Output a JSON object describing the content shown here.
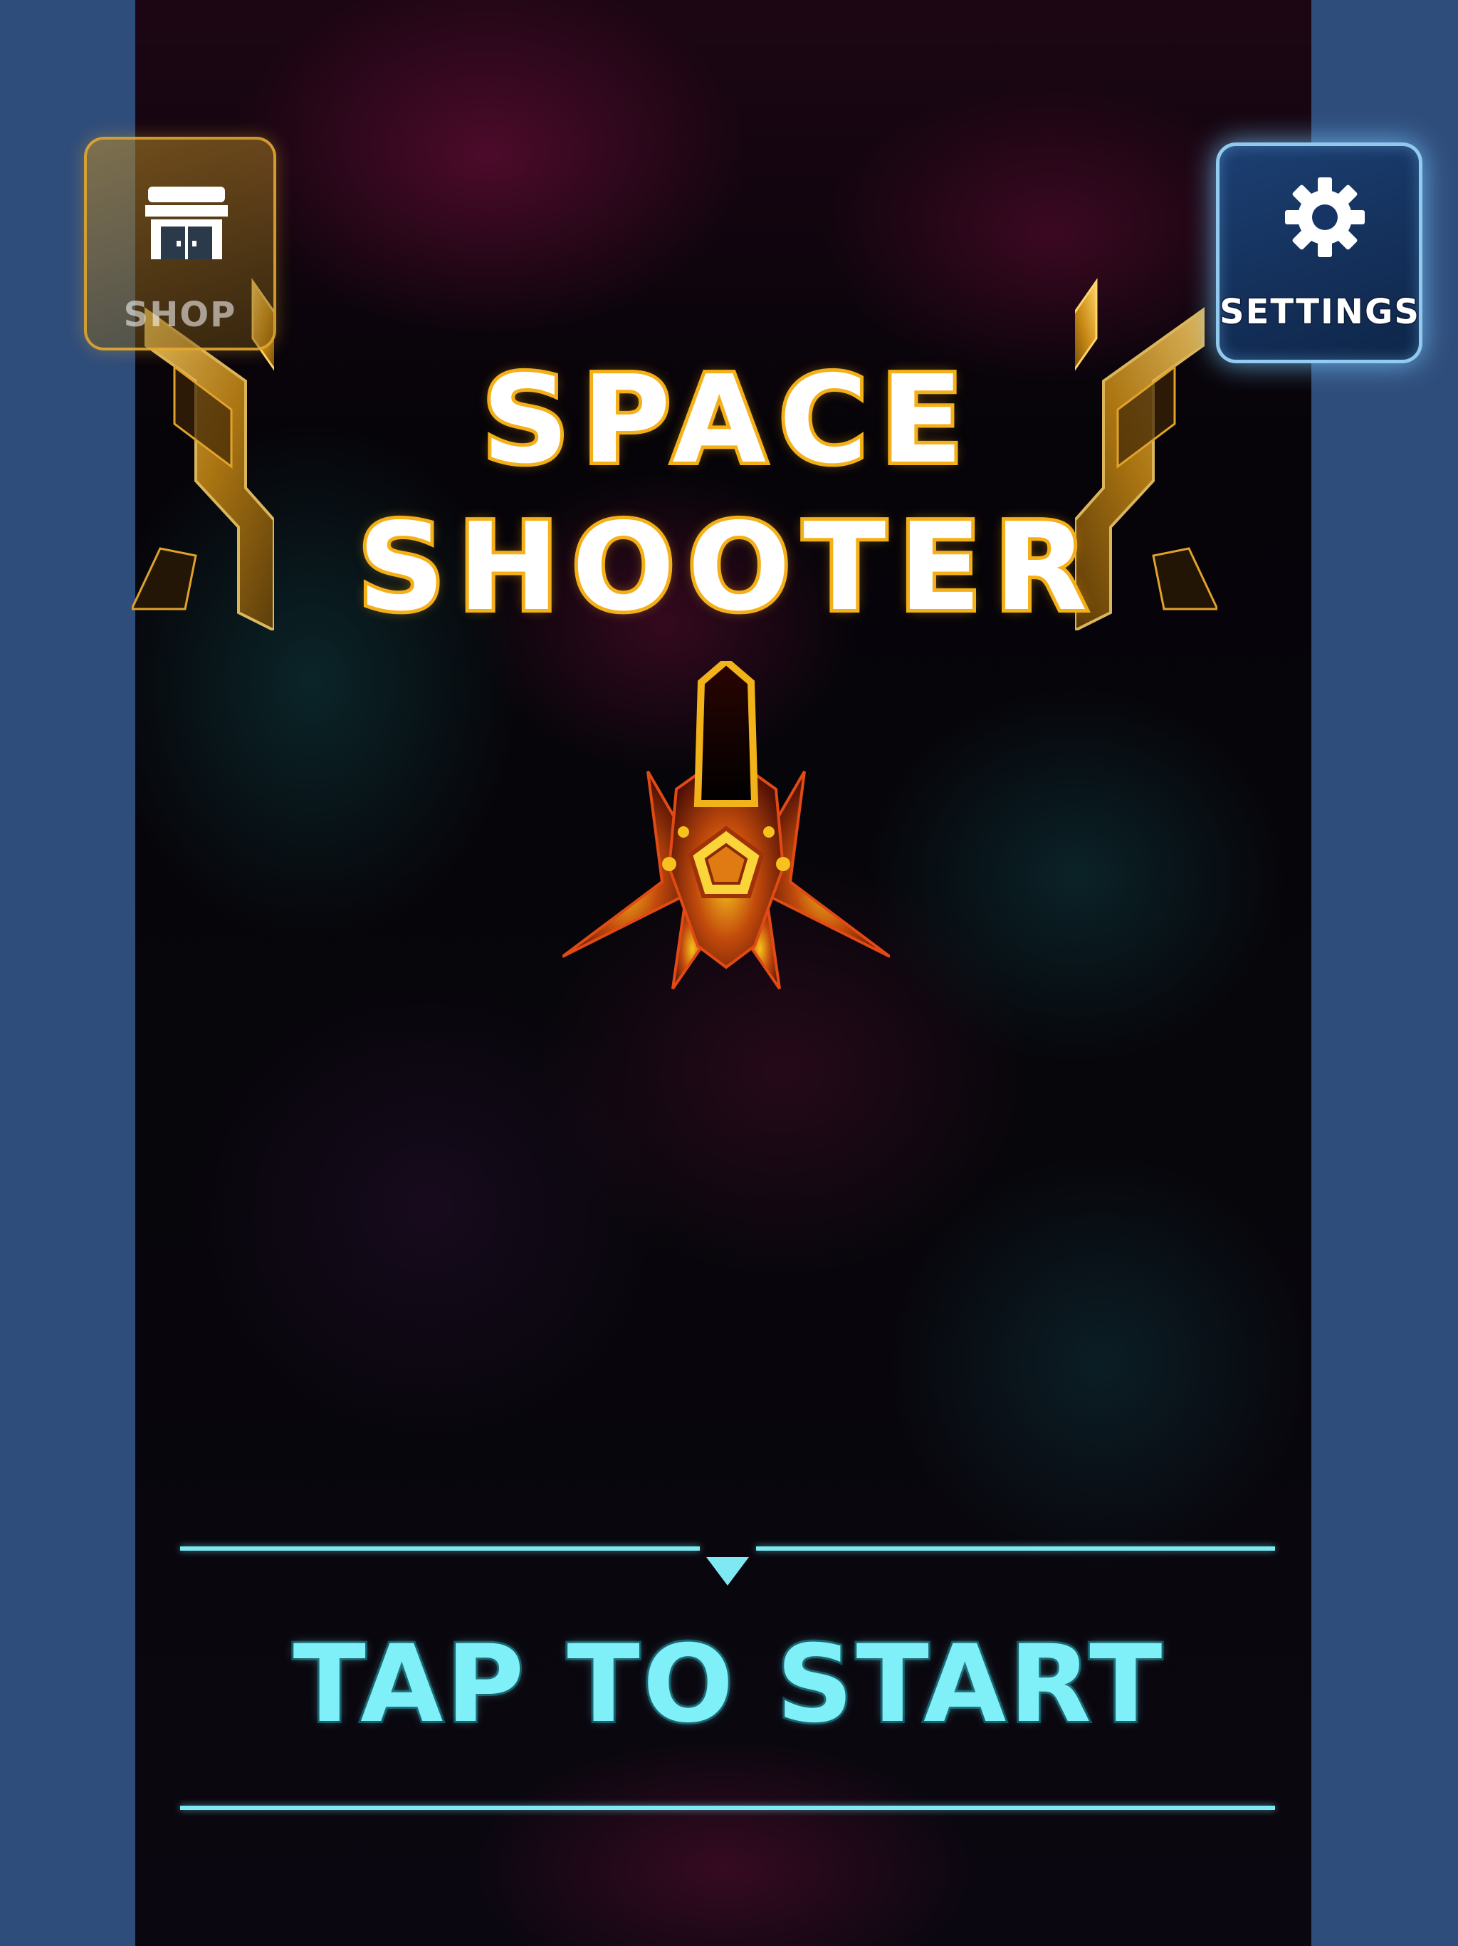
{
  "title": {
    "line1": "SPACE",
    "line2": "SHOOTER"
  },
  "buttons": {
    "shop": {
      "label": "SHOP",
      "icon": "storefront-icon"
    },
    "settings": {
      "label": "SETTINGS",
      "icon": "gear-icon"
    }
  },
  "prompt": {
    "label": "TAP TO START"
  },
  "colors": {
    "title_outline": "#f2b21a",
    "accent_cyan": "#7fe9f3",
    "side_background": "#2f4d7b",
    "ship_glow": "#e8a514"
  },
  "ship": {
    "icon": "player-spaceship"
  }
}
